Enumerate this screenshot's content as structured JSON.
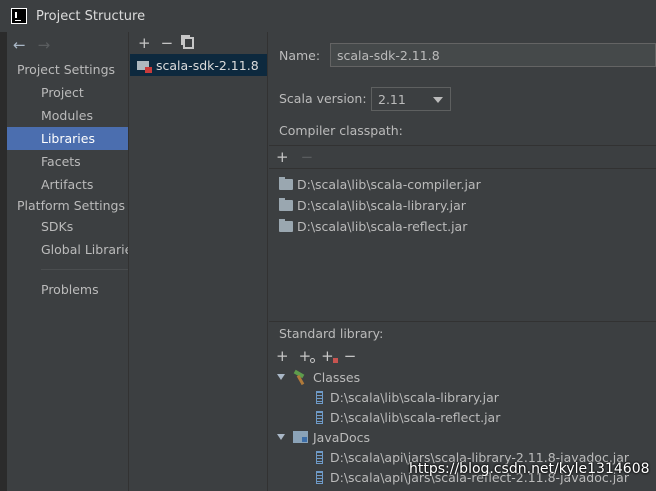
{
  "window": {
    "title": "Project Structure"
  },
  "nav": {
    "back_icon": "arrow-left",
    "forward_icon": "arrow-right",
    "project_settings_heading": "Project Settings",
    "project_items": [
      "Project",
      "Modules",
      "Libraries",
      "Facets",
      "Artifacts"
    ],
    "platform_settings_heading": "Platform Settings",
    "platform_items": [
      "SDKs",
      "Global Libraries"
    ],
    "other_items": [
      "Problems"
    ],
    "selected": "Libraries"
  },
  "libraries": {
    "toolbar": {
      "add": "+",
      "remove": "−",
      "copy_icon": "copy-icon"
    },
    "items": [
      "scala-sdk-2.11.8"
    ]
  },
  "details": {
    "name_label": "Name:",
    "name_value": "scala-sdk-2.11.8",
    "scala_version_label": "Scala version:",
    "scala_version_value": "2.11",
    "compiler_classpath_label": "Compiler classpath:",
    "classpath_toolbar": {
      "add": "+",
      "remove": "−"
    },
    "classpath": [
      "D:\\scala\\lib\\scala-compiler.jar",
      "D:\\scala\\lib\\scala-library.jar",
      "D:\\scala\\lib\\scala-reflect.jar"
    ],
    "standard_library_label": "Standard library:",
    "std_toolbar": {
      "add": "+",
      "remove": "−"
    },
    "classes": {
      "label": "Classes",
      "items": [
        "D:\\scala\\lib\\scala-library.jar",
        "D:\\scala\\lib\\scala-reflect.jar"
      ]
    },
    "javadocs": {
      "label": "JavaDocs",
      "items": [
        "D:\\scala\\api\\jars\\scala-library-2.11.8-javadoc.jar",
        "D:\\scala\\api\\jars\\scala-reflect-2.11.8-javadoc.jar"
      ]
    }
  },
  "watermark": "https://blog.csdn.net/kyle1314608",
  "colors": {
    "selection": "#4b6eaf",
    "background": "#3c3f41",
    "list_selection": "#0d293e"
  }
}
